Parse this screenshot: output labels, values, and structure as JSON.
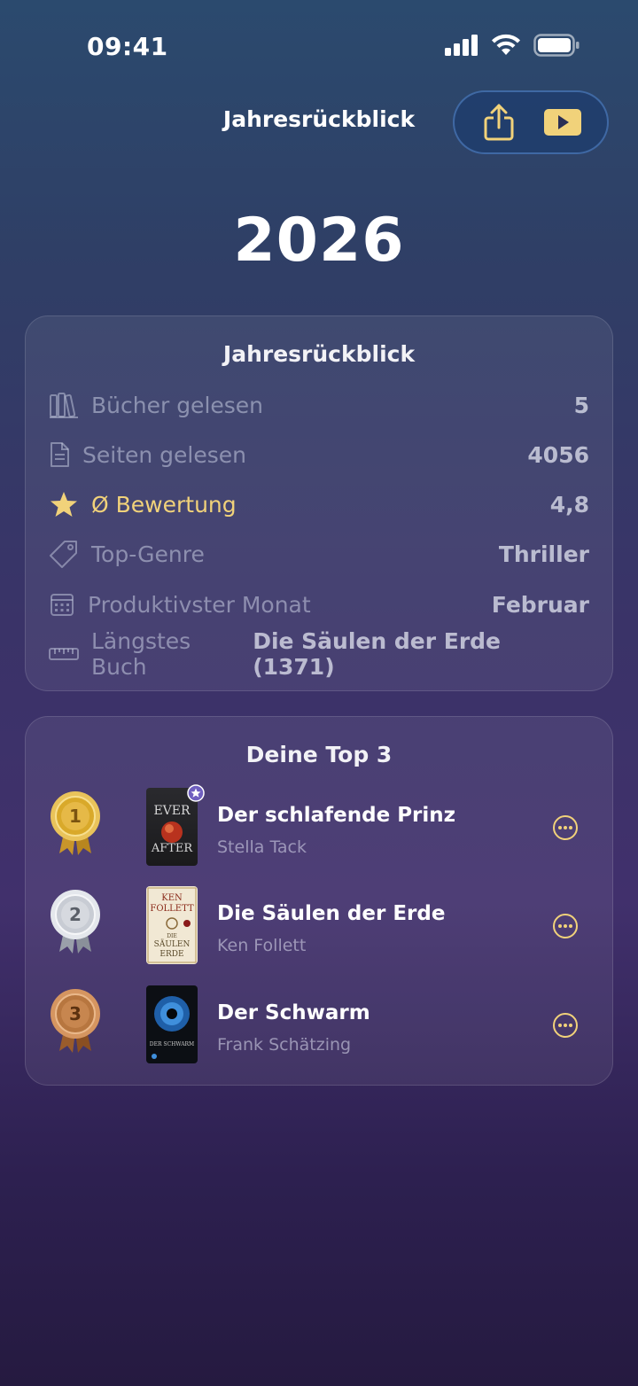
{
  "status": {
    "time": "09:41"
  },
  "header": {
    "title": "Jahresrückblick",
    "share_icon": "share-icon",
    "play_icon": "play-icon"
  },
  "year": "2026",
  "stats": {
    "title": "Jahresrückblick",
    "rows": [
      {
        "icon": "books-icon",
        "label": "Bücher gelesen",
        "value": "5"
      },
      {
        "icon": "document-icon",
        "label": "Seiten gelesen",
        "value": "4056"
      },
      {
        "icon": "star-icon",
        "label": "Ø Bewertung",
        "value": "4,8"
      },
      {
        "icon": "tag-icon",
        "label": "Top-Genre",
        "value": "Thriller"
      },
      {
        "icon": "calendar-icon",
        "label": "Produktivster Monat",
        "value": "Februar"
      },
      {
        "icon": "ruler-icon",
        "label": "Längstes Buch",
        "value": "Die Säulen der Erde (1371)"
      }
    ]
  },
  "top3": {
    "title": "Deine Top 3",
    "books": [
      {
        "rank": "1",
        "title": "Der schlafende Prinz",
        "author": "Stella Tack",
        "cover_text": [
          "EVER",
          "AFTER"
        ]
      },
      {
        "rank": "2",
        "title": "Die Säulen der Erde",
        "author": "Ken Follett",
        "cover_text": [
          "KEN",
          "FOLLETT",
          "DIE",
          "SÄULEN",
          "ERDE"
        ]
      },
      {
        "rank": "3",
        "title": "Der Schwarm",
        "author": "Frank Schätzing",
        "cover_text": [
          "DER SCHWARM"
        ]
      }
    ]
  },
  "colors": {
    "accent": "#f1d27a",
    "gold": "#d9a92a",
    "silver": "#c8ccd4",
    "bronze": "#b7763f"
  }
}
